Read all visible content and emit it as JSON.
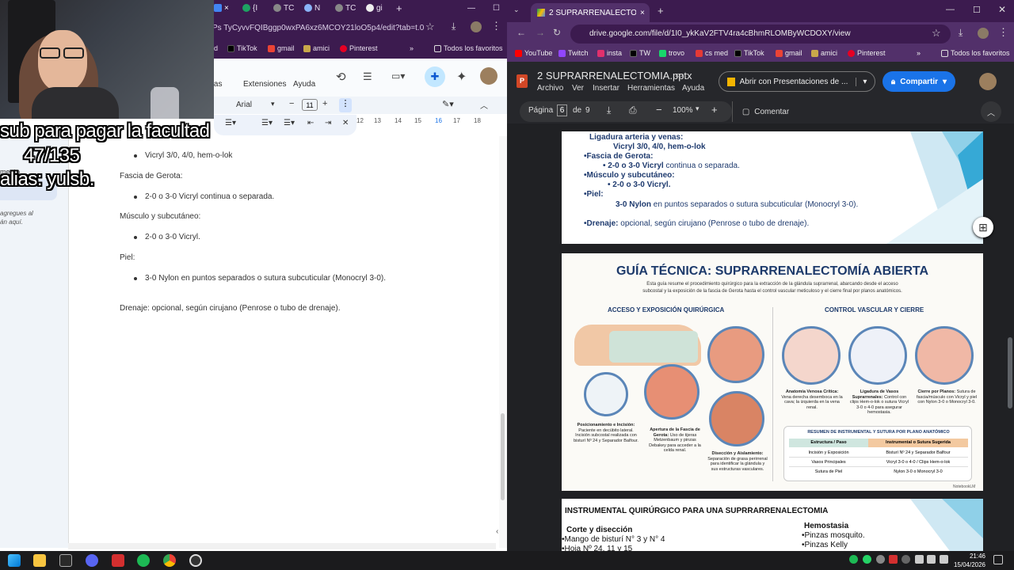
{
  "left_window": {
    "tabs": [
      {
        "label": "{I",
        "icon_color": "#1ea362"
      },
      {
        "label": "TC",
        "icon_color": "#bbbbbb"
      },
      {
        "label": "N",
        "icon_color": "#8ab4f8"
      },
      {
        "label": "TC",
        "icon_color": "#bbbbbb"
      },
      {
        "label": "gi",
        "icon_color": "#eeeeee"
      }
    ],
    "url": "Ps TyCyvvFQIBggp0wxPA6xz6MCOY21loO5p4/edit?tab=t.0",
    "bookmarks": [
      {
        "label": "d",
        "color": "#ffffff"
      },
      {
        "label": "TikTok",
        "color": "#000000"
      },
      {
        "label": "gmail",
        "color": "#ea4335"
      },
      {
        "label": "amici",
        "color": "#c9a84a"
      },
      {
        "label": "Pinterest",
        "color": "#e60023"
      }
    ],
    "all_favorites": "Todos los favoritos",
    "menu": [
      "entas",
      "Extensiones",
      "Ayuda"
    ],
    "font_name": "Arial",
    "font_size": "11",
    "ruler_ticks": [
      "12",
      "13",
      "14",
      "15",
      "16",
      "17",
      "18"
    ],
    "side_hint_line1": "agregues al",
    "side_hint_line2": "án aquí.",
    "side_cut": "mento",
    "doc": {
      "b1": "Vicryl 3/0, 4/0, hem-o-lok",
      "h_gerota": "Fascia de Gerota:",
      "b2": "2-0 o 3-0 Vicryl continua o separada.",
      "h_musculo": "Músculo y subcutáneo:",
      "b3": "2-0 o 3-0 Vicryl.",
      "h_piel": "Piel:",
      "b4": "3-0 Nylon en puntos separados o sutura subcuticular (Monocryl 3-0).",
      "drenaje": "Drenaje: opcional, según cirujano (Penrose o tubo de drenaje)."
    },
    "overlay": {
      "line1": "sub para pagar la facultad",
      "line2": "47/135",
      "line3": "alias: yulsb."
    }
  },
  "right_window": {
    "tab_title": "2 SUPRARRENALECTOMIA.pptx",
    "url": "drive.google.com/file/d/1I0_ykKaV2FTV4ra4cBhmRLOMByWCDOXY/view",
    "bookmarks": [
      {
        "label": "YouTube",
        "color": "#ff0000"
      },
      {
        "label": "Twitch",
        "color": "#9146ff"
      },
      {
        "label": "insta",
        "color": "#e1306c"
      },
      {
        "label": "TW",
        "color": "#000000"
      },
      {
        "label": "trovo",
        "color": "#19d66b"
      },
      {
        "label": "cs med",
        "color": "#e53935"
      },
      {
        "label": "TikTok",
        "color": "#000000"
      },
      {
        "label": "gmail",
        "color": "#ea4335"
      },
      {
        "label": "amici",
        "color": "#c9a84a"
      },
      {
        "label": "Pinterest",
        "color": "#e60023"
      }
    ],
    "all_favorites": "Todos los favoritos",
    "file_title": "2 SUPRARRENALECTOMIA.pptx",
    "menu": [
      "Archivo",
      "Ver",
      "Insertar",
      "Herramientas",
      "Ayuda"
    ],
    "open_with": "Abrir con Presentaciones de ...",
    "share": "Compartir",
    "page_label": "Página",
    "page_num": "6",
    "page_of": "de",
    "page_total": "9",
    "zoom": "100%",
    "comment": "Comentar",
    "slide1": {
      "l1": "Ligadura arteria y venas:",
      "l2": "Vicryl 3/0,  4/0, hem-o-lok",
      "l3": "•Fascia de Gerota:",
      "l4": "• 2-0 o 3-0 Vicryl",
      "l4b": " continua o separada.",
      "l5": "•Músculo y subcutáneo:",
      "l6": "• 2-0 o 3-0 Vicryl.",
      "l7": "•Piel:",
      "l8": "3-0 Nylon",
      "l8b": " en puntos separados o sutura subcuticular (Monocryl 3-0).",
      "l9": "•Drenaje:",
      "l9b": " opcional, según cirujano (Penrose o tubo de drenaje)."
    },
    "slide2": {
      "title": "GUÍA TÉCNICA: SUPRARRENALECTOMÍA ABIERTA",
      "subtitle1": "Esta guía resume el procedimiento quirúrgico para la extracción de la glándula suprarrenal, abarcando desde el acceso",
      "subtitle2": "subcostal y la exposición de la fascia de Gerota hasta el control vascular meticuloso y el cierre final por planos anatómicos.",
      "sec_left": "ACCESO Y EXPOSICIÓN QUIRÚRGICA",
      "sec_right": "CONTROL VASCULAR Y CIERRE",
      "cap_pos": "Posicionamiento e Incisión:",
      "cap_pos_t": "Paciente en decúbito lateral. Incisión subcostal realizada con bisturí Nº 24 y Separador Balfour.",
      "cap_ap": "Apertura de la Fascia de Gerota:",
      "cap_ap_t": "Uso de tijeras Metzenbaum y pinzas Debakey para acceder a la celda renal.",
      "cap_dis": "Disección y Aislamiento:",
      "cap_dis_t": "Separación de grasa perirrenal para identificar la glándula y sus estructuras vasculares.",
      "cap_anat": "Anatomía Venosa Crítica:",
      "cap_anat_t": "Vena derecha desemboca en la cava; la izquierda en la vena renal.",
      "cap_lig": "Ligadura de Vasos Suprarrenales:",
      "cap_lig_t": "Control con clips Hem-o-lok o sutura Vicryl 3-0 o 4-0 para asegurar hemostasia.",
      "cap_cie": "Cierre por Planos:",
      "cap_cie_t": "Sutura de fascia/músculo con Vicryl y piel con Nylon 3-0 o Monocryl 3-0.",
      "table_title": "RESUMEN DE INSTRUMENTAL Y SUTURA POR PLANO ANATÓMICO",
      "table_headers": [
        "Estructura / Paso",
        "Instrumental o Sutura Sugerida"
      ],
      "table_rows": [
        [
          "Incisión y Exposición",
          "Bisturí Nº 24 y Separador Balfour"
        ],
        [
          "Vasos Principales",
          "Vicryl 3-0 o 4-0 / Clips Hem-o-lok"
        ],
        [
          "Sutura de Piel",
          "Nylon 3-0 o Monocryl 3-0"
        ]
      ],
      "brand": "NotebookLM"
    },
    "slide3": {
      "title": "INSTRUMENTAL QUIRÚRGICO PARA UNA SUPRRARRENALECTOMIA",
      "h_left": "Corte y disección",
      "l1": "•Mango de bisturí N° 3 y N° 4",
      "l2": "•Hoja Nº 24, 11 y 15",
      "h_right": "Hemostasia",
      "r1": "•Pinzas mosquito.",
      "r2": "•Pinzas Kelly"
    }
  },
  "taskbar": {
    "time": "21:46",
    "date": "15/04/2026"
  },
  "colors": {
    "browser_frame": "#3c1b4f",
    "share_button": "#1a73e8",
    "slide_title_blue": "#1f3b6f",
    "guide_title": "#1d3a6b"
  }
}
